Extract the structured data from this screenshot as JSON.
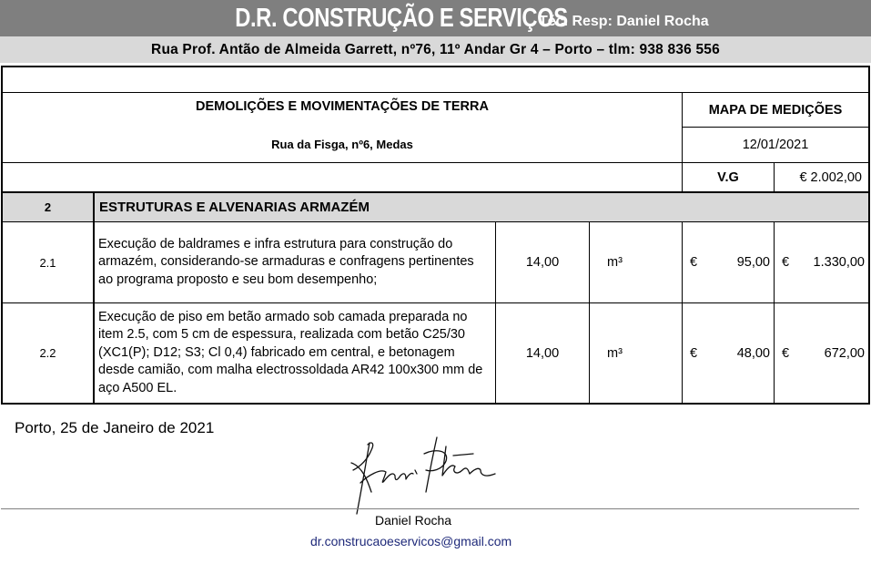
{
  "header": {
    "company": "D.R.  CONSTRUÇÃO E SERVIÇOS",
    "tech_responsible": "Téc. Resp: Daniel Rocha",
    "address": "Rua Prof. Antão de Almeida Garrett, nº76, 11º Andar Gr 4 – Porto – tlm: 938 836 556"
  },
  "document": {
    "title": "DEMOLIÇÕES E MOVIMENTAÇÕES DE TERRA",
    "site_address": "Rua da Fisga, nº6, Medas",
    "doc_type": "MAPA DE MEDIÇÕES",
    "date": "12/01/2021",
    "vg_label": "V.G",
    "vg_value": "€ 2.002,00"
  },
  "section": {
    "number": "2",
    "title": "ESTRUTURAS E ALVENARIAS ARMAZÉM"
  },
  "items": [
    {
      "num": "2.1",
      "description": "Execução de baldrames e infra estrutura para construção do armazém, considerando-se armaduras e confragens pertinentes ao programa proposto e seu bom desempenho;",
      "quantity": "14,00",
      "unit": "m³",
      "currency": "€",
      "unit_price": "95,00",
      "total": "1.330,00"
    },
    {
      "num": "2.2",
      "description": "Execução de piso em betão armado sob camada preparada no item 2.5, com 5 cm de espessura, realizada com betão C25/30 (XC1(P); D12; S3; Cl 0,4) fabricado em central, e betonagem desde camião, com malha electrossoldada AR42 100x300 mm de aço A500 EL.",
      "quantity": "14,00",
      "unit": "m³",
      "currency": "€",
      "unit_price": "48,00",
      "total": "672,00"
    }
  ],
  "footer": {
    "place_date": "Porto, 25 de Janeiro de 2021",
    "signature_name": "Daniel Rocha",
    "email": "dr.construcaoeservicos@gmail.com"
  }
}
